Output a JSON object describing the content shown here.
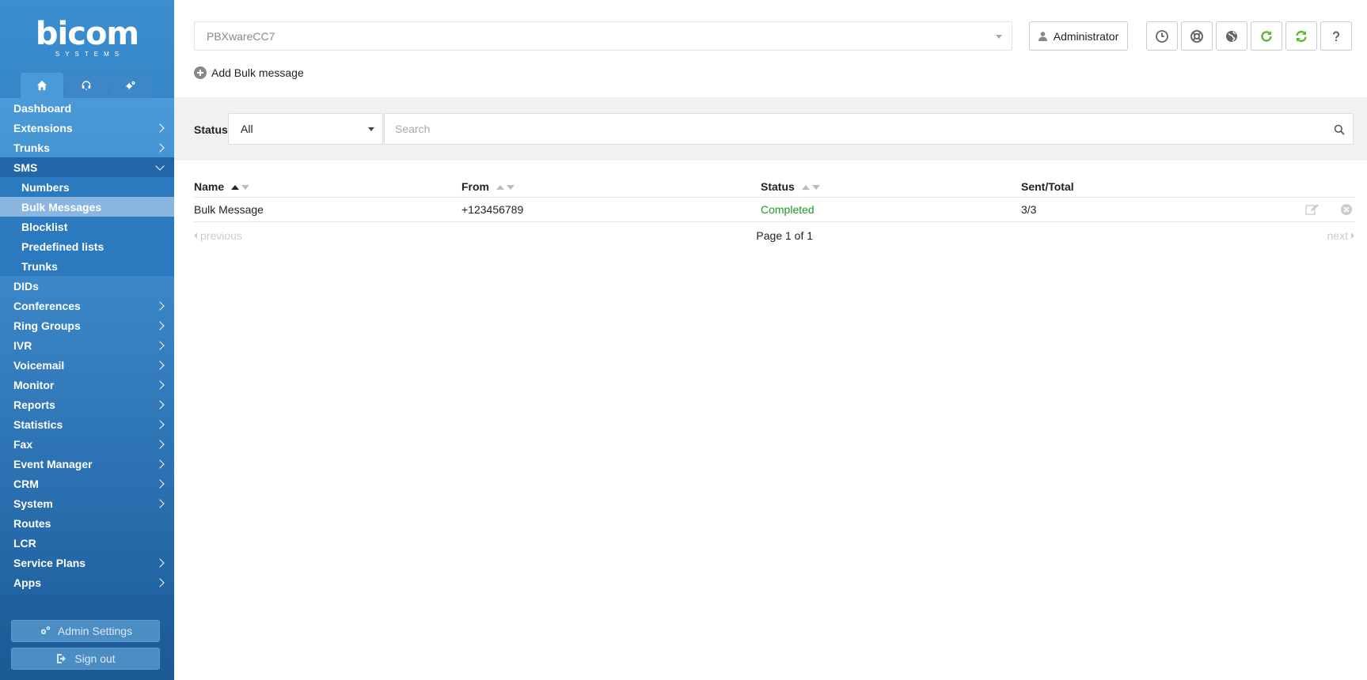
{
  "brand": {
    "logo": "bicom",
    "sub": "SYSTEMS"
  },
  "sidebar": {
    "top_tabs": [
      "home-icon",
      "headset-icon",
      "gears-icon"
    ],
    "menu": [
      {
        "label": "Dashboard",
        "has_children": false
      },
      {
        "label": "Extensions",
        "has_children": true
      },
      {
        "label": "Trunks",
        "has_children": true
      },
      {
        "label": "SMS",
        "has_children": true,
        "open": true
      },
      {
        "label": "DIDs",
        "has_children": false
      },
      {
        "label": "Conferences",
        "has_children": true
      },
      {
        "label": "Ring Groups",
        "has_children": true
      },
      {
        "label": "IVR",
        "has_children": true
      },
      {
        "label": "Voicemail",
        "has_children": true
      },
      {
        "label": "Monitor",
        "has_children": true
      },
      {
        "label": "Reports",
        "has_children": true
      },
      {
        "label": "Statistics",
        "has_children": true
      },
      {
        "label": "Fax",
        "has_children": true
      },
      {
        "label": "Event Manager",
        "has_children": true
      },
      {
        "label": "CRM",
        "has_children": true
      },
      {
        "label": "System",
        "has_children": true
      },
      {
        "label": "Routes",
        "has_children": false
      },
      {
        "label": "LCR",
        "has_children": false
      },
      {
        "label": "Service Plans",
        "has_children": true
      },
      {
        "label": "Apps",
        "has_children": true
      }
    ],
    "sms_sub": [
      "Numbers",
      "Bulk Messages",
      "Blocklist",
      "Predefined lists",
      "Trunks"
    ],
    "sms_active": "Bulk Messages",
    "admin_settings": "Admin Settings",
    "sign_out": "Sign out"
  },
  "header": {
    "server_select": "PBXwareCC7",
    "user": "Administrator",
    "icons": [
      "clock-icon",
      "lifebuoy-icon",
      "globe-icon",
      "reload-icon",
      "sync-icon",
      "help-icon"
    ],
    "green": "#5cb82e"
  },
  "actions": {
    "add": "Add Bulk message"
  },
  "filter": {
    "status_label": "Status",
    "status_value": "All",
    "search_placeholder": "Search"
  },
  "table": {
    "columns": [
      "Name",
      "From",
      "Status",
      "Sent/Total"
    ],
    "rows": [
      {
        "name": "Bulk Message",
        "from": "+123456789",
        "status": "Completed",
        "sent_total": "3/3"
      }
    ]
  },
  "pager": {
    "previous": "previous",
    "page": "Page 1 of 1",
    "next": "next"
  }
}
